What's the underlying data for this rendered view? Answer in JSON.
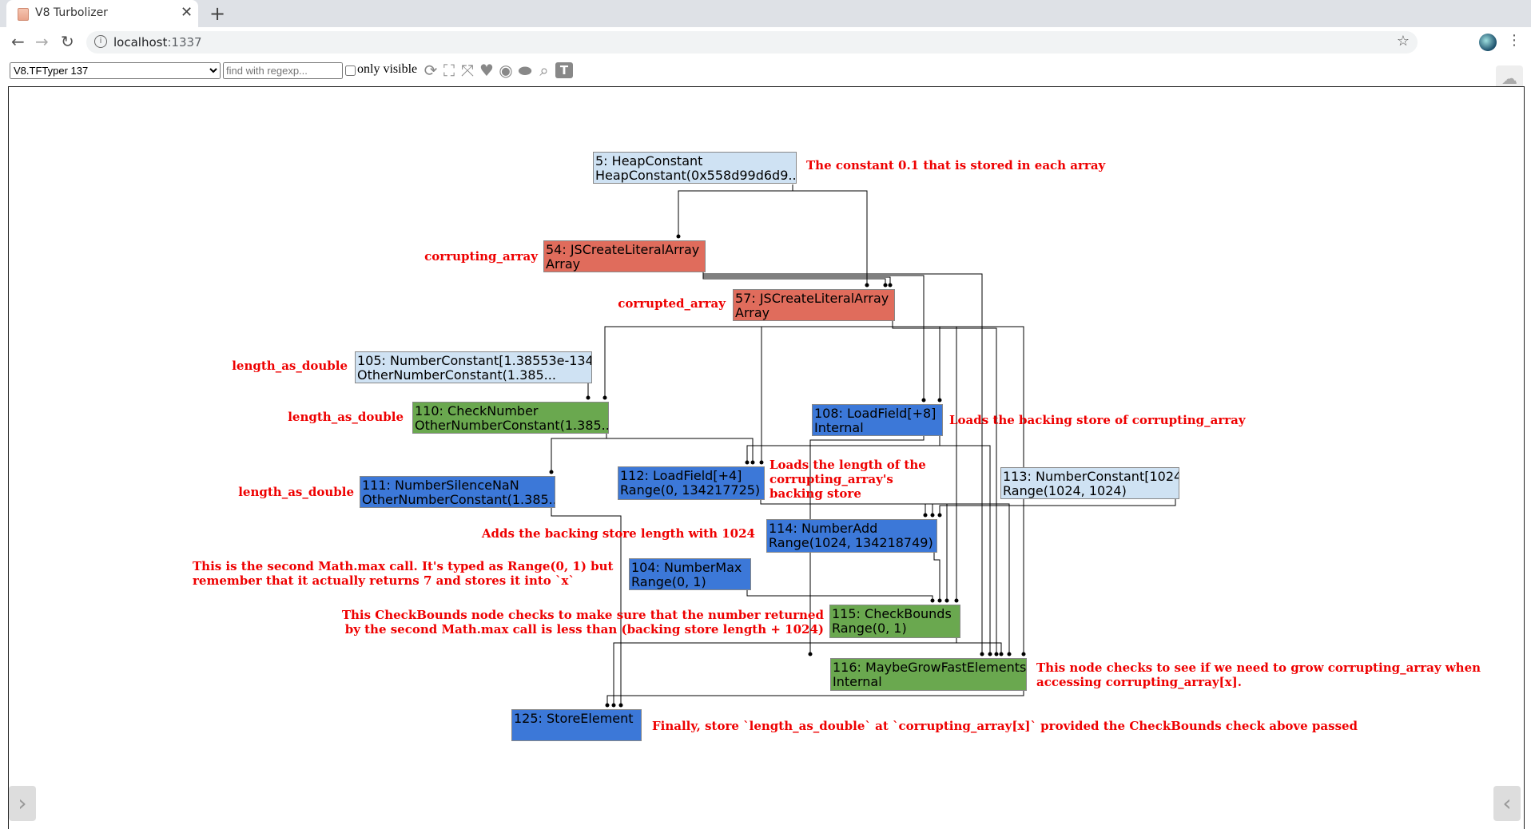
{
  "browser": {
    "tab_title": "V8 Turbolizer",
    "url_host": "localhost",
    "url_port": ":1337"
  },
  "header": {
    "phase_selected": "V8.TFTyper 137",
    "search_placeholder": "find with regexp...",
    "only_visible_label": "only visible"
  },
  "colors": {
    "constant": "#cfe2f3",
    "js_node": "#e06c5c",
    "check_node": "#6aa84f",
    "simplified": "#3c78d8",
    "annotation": "#ee0000"
  },
  "nodes": [
    {
      "id": "5",
      "l1": "5: HeapConstant",
      "l2": "HeapConstant(0x558d99d6d9...",
      "kind": "constant"
    },
    {
      "id": "54",
      "l1": "54: JSCreateLiteralArray",
      "l2": "Array",
      "kind": "js_node"
    },
    {
      "id": "57",
      "l1": "57: JSCreateLiteralArray",
      "l2": "Array",
      "kind": "js_node"
    },
    {
      "id": "105",
      "l1": "105: NumberConstant[1.38553e-134]",
      "l2": "OtherNumberConstant(1.385...",
      "kind": "constant"
    },
    {
      "id": "110",
      "l1": "110: CheckNumber",
      "l2": "OtherNumberConstant(1.385...",
      "kind": "check_node"
    },
    {
      "id": "108",
      "l1": "108: LoadField[+8]",
      "l2": "Internal",
      "kind": "simplified"
    },
    {
      "id": "111",
      "l1": "111: NumberSilenceNaN",
      "l2": "OtherNumberConstant(1.385...",
      "kind": "simplified"
    },
    {
      "id": "112",
      "l1": "112: LoadField[+4]",
      "l2": "Range(0, 134217725)",
      "kind": "simplified"
    },
    {
      "id": "113",
      "l1": "113: NumberConstant[1024]",
      "l2": "Range(1024, 1024)",
      "kind": "constant"
    },
    {
      "id": "114",
      "l1": "114: NumberAdd",
      "l2": "Range(1024, 134218749)",
      "kind": "simplified"
    },
    {
      "id": "104",
      "l1": "104: NumberMax",
      "l2": "Range(0, 1)",
      "kind": "simplified"
    },
    {
      "id": "115",
      "l1": "115: CheckBounds",
      "l2": "Range(0, 1)",
      "kind": "check_node"
    },
    {
      "id": "116",
      "l1": "116: MaybeGrowFastElements",
      "l2": "Internal",
      "kind": "check_node"
    },
    {
      "id": "125",
      "l1": "125: StoreElement",
      "l2": "",
      "kind": "simplified"
    }
  ],
  "annotations": {
    "a5": "The constant 0.1 that is stored in each array",
    "a54": "corrupting_array",
    "a57": "corrupted_array",
    "a105": "length_as_double",
    "a110": "length_as_double",
    "a108": "Loads the backing store of corrupting_array",
    "a111": "length_as_double",
    "a112_1": "Loads the length of the",
    "a112_2": "corrupting_array's",
    "a112_3": "backing store",
    "a114": "Adds the backing store length with 1024",
    "a104_1": "This is the second Math.max call. It's typed as Range(0, 1) but",
    "a104_2": "remember that it actually returns 7 and stores it into `x`",
    "a115_1": "This CheckBounds node checks to make sure that the number returned",
    "a115_2": "by the second Math.max call is less than (backing store length + 1024)",
    "a116_1": "This node checks to see if we need to grow corrupting_array when",
    "a116_2": "accessing corrupting_array[x].",
    "a125": "Finally, store `length_as_double` at `corrupting_array[x]` provided the CheckBounds check above passed"
  }
}
